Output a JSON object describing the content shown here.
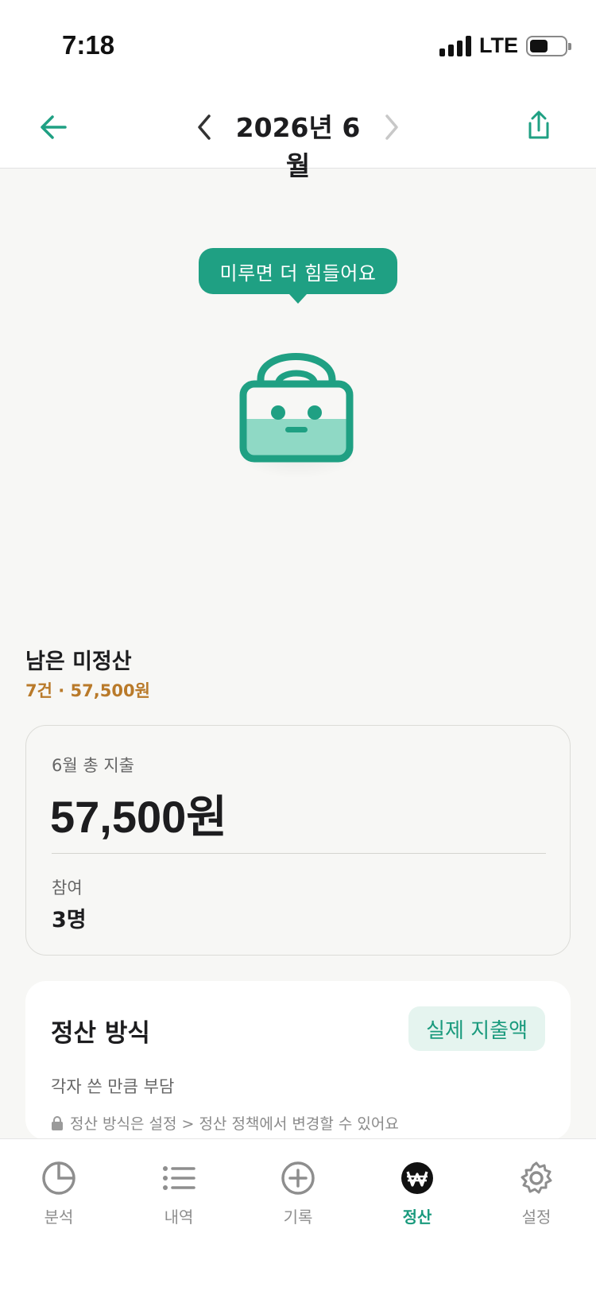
{
  "status": {
    "time": "7:18",
    "network": "LTE"
  },
  "nav": {
    "title": "2026년 6월",
    "back_icon": "arrow-left-icon",
    "prev_icon": "chevron-left-icon",
    "next_icon": "chevron-right-icon",
    "share_icon": "share-icon"
  },
  "hero": {
    "bubble_text": "미루면 더 힘들어요",
    "mascot_icon": "bag-mascot-icon"
  },
  "unsettled": {
    "title": "남은 미정산",
    "summary": "7건 · 57,500원"
  },
  "summary": {
    "label": "6월 총 지출",
    "amount": "57,500원",
    "participants_label": "참여",
    "participants_value": "3명"
  },
  "method": {
    "title": "정산 방식",
    "badge": "실제 지출액",
    "description": "각자 쓴 만큼 부담",
    "note": "정산 방식은 설정 > 정산 정책에서 변경할 수 있어요"
  },
  "tabs": [
    {
      "label": "분석",
      "icon": "pie-chart-icon"
    },
    {
      "label": "내역",
      "icon": "list-icon"
    },
    {
      "label": "기록",
      "icon": "plus-circle-icon"
    },
    {
      "label": "정산",
      "icon": "won-icon"
    },
    {
      "label": "설정",
      "icon": "gear-icon"
    }
  ],
  "colors": {
    "accent": "#1fa083",
    "warning_text": "#b97a2a",
    "background": "#f7f7f5"
  }
}
